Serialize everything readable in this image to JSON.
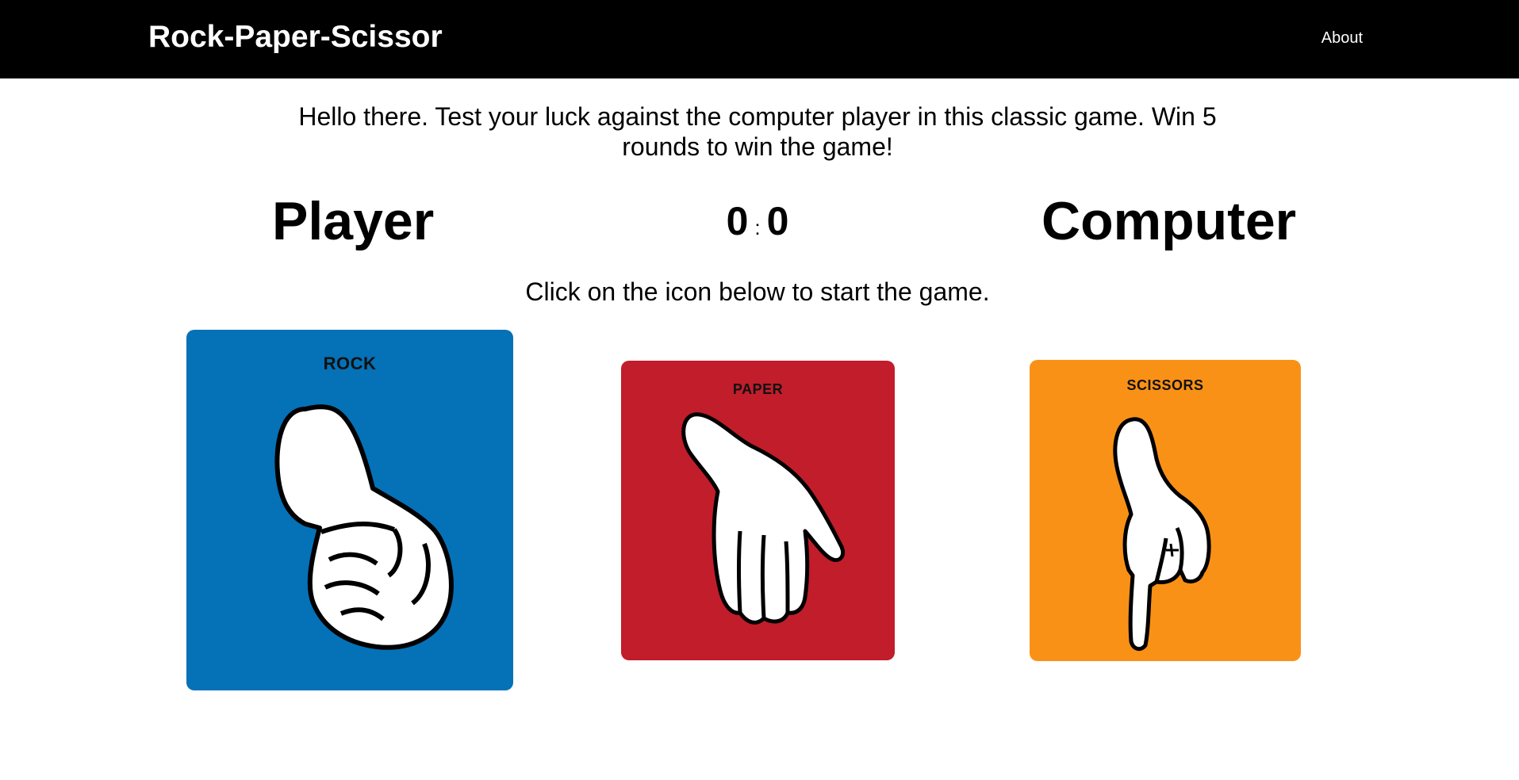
{
  "nav": {
    "brand": "Rock-Paper-Scissor",
    "about": "About"
  },
  "intro": "Hello there. Test your luck against the computer player in this classic game. Win 5 rounds to win the game!",
  "scoreboard": {
    "player_label": "Player",
    "computer_label": "Computer",
    "player_score": "0",
    "separator": ":",
    "computer_score": "0"
  },
  "instruction": "Click on the icon below to start the game.",
  "choices": [
    {
      "title": "ROCK",
      "color": "#0571b7",
      "icon": "fist-icon"
    },
    {
      "title": "PAPER",
      "color": "#c11d2b",
      "icon": "open-hand-icon"
    },
    {
      "title": "SCISSORS",
      "color": "#f99117",
      "icon": "two-finger-icon"
    }
  ]
}
